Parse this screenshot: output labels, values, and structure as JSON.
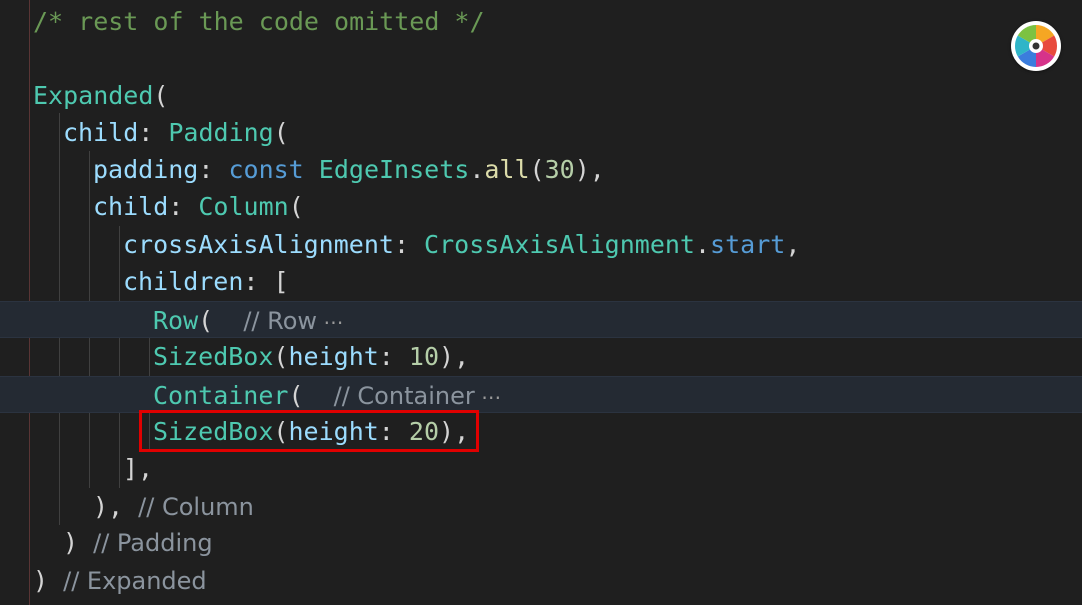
{
  "editor": {
    "lines": [
      {
        "tokens": [
          {
            "t": "/* rest of the code omitted */",
            "c": "t-comment"
          }
        ]
      },
      {
        "tokens": []
      },
      {
        "tokens": [
          {
            "t": "Expanded",
            "c": "t-class"
          },
          {
            "t": "(",
            "c": "t-punc"
          }
        ]
      },
      {
        "tokens": [
          {
            "t": "child",
            "c": "t-prop"
          },
          {
            "t": ": ",
            "c": "t-punc"
          },
          {
            "t": "Padding",
            "c": "t-class"
          },
          {
            "t": "(",
            "c": "t-punc"
          }
        ]
      },
      {
        "tokens": [
          {
            "t": "padding",
            "c": "t-prop"
          },
          {
            "t": ": ",
            "c": "t-punc"
          },
          {
            "t": "const",
            "c": "t-keyword"
          },
          {
            "t": " ",
            "c": "t-punc"
          },
          {
            "t": "EdgeInsets",
            "c": "t-class"
          },
          {
            "t": ".",
            "c": "t-punc"
          },
          {
            "t": "all",
            "c": "t-func"
          },
          {
            "t": "(",
            "c": "t-punc"
          },
          {
            "t": "30",
            "c": "t-num"
          },
          {
            "t": "),",
            "c": "t-punc"
          }
        ]
      },
      {
        "tokens": [
          {
            "t": "child",
            "c": "t-prop"
          },
          {
            "t": ": ",
            "c": "t-punc"
          },
          {
            "t": "Column",
            "c": "t-class"
          },
          {
            "t": "(",
            "c": "t-punc"
          }
        ]
      },
      {
        "tokens": [
          {
            "t": "crossAxisAlignment",
            "c": "t-prop"
          },
          {
            "t": ": ",
            "c": "t-punc"
          },
          {
            "t": "CrossAxisAlignment",
            "c": "t-class"
          },
          {
            "t": ".",
            "c": "t-punc"
          },
          {
            "t": "start",
            "c": "t-keyword"
          },
          {
            "t": ",",
            "c": "t-punc"
          }
        ]
      },
      {
        "tokens": [
          {
            "t": "children",
            "c": "t-prop"
          },
          {
            "t": ": [",
            "c": "t-punc"
          }
        ]
      },
      {
        "tokens": [
          {
            "t": "Row",
            "c": "t-class"
          },
          {
            "t": "(  ",
            "c": "t-punc"
          },
          {
            "t": "// Row",
            "c": "t-comment2"
          },
          {
            "t": " ⋯",
            "c": "ellipsis"
          }
        ]
      },
      {
        "tokens": [
          {
            "t": "SizedBox",
            "c": "t-class"
          },
          {
            "t": "(",
            "c": "t-punc"
          },
          {
            "t": "height",
            "c": "t-prop"
          },
          {
            "t": ": ",
            "c": "t-punc"
          },
          {
            "t": "10",
            "c": "t-num"
          },
          {
            "t": "),",
            "c": "t-punc"
          }
        ]
      },
      {
        "tokens": [
          {
            "t": "Container",
            "c": "t-class"
          },
          {
            "t": "(  ",
            "c": "t-punc"
          },
          {
            "t": "// Container",
            "c": "t-comment2"
          },
          {
            "t": " ⋯",
            "c": "ellipsis"
          }
        ]
      },
      {
        "tokens": [
          {
            "t": "SizedBox",
            "c": "t-class"
          },
          {
            "t": "(",
            "c": "t-punc"
          },
          {
            "t": "height",
            "c": "t-prop"
          },
          {
            "t": ": ",
            "c": "t-punc"
          },
          {
            "t": "20",
            "c": "t-num"
          },
          {
            "t": "),",
            "c": "t-punc"
          }
        ]
      },
      {
        "tokens": [
          {
            "t": "],",
            "c": "t-punc"
          }
        ]
      },
      {
        "tokens": [
          {
            "t": "), ",
            "c": "t-punc"
          },
          {
            "t": "// Column",
            "c": "t-comment2"
          }
        ]
      },
      {
        "tokens": [
          {
            "t": ") ",
            "c": "t-punc"
          },
          {
            "t": "// Padding",
            "c": "t-comment2"
          }
        ]
      },
      {
        "tokens": [
          {
            "t": ") ",
            "c": "t-punc"
          },
          {
            "t": "// Expanded",
            "c": "t-comment2"
          }
        ]
      }
    ]
  },
  "highlight": {
    "color": "#e00000",
    "line_text": "SizedBox(height: 20),"
  },
  "overlay_icon": "color-wheel-icon",
  "colors": {
    "background": "#1f1f1f",
    "folded_line": "#242a33"
  }
}
